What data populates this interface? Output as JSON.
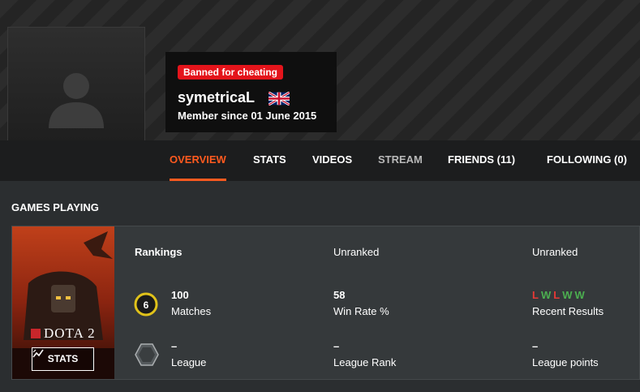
{
  "profile": {
    "ban_badge": "Banned for cheating",
    "username": "symetricaL",
    "member_since": "Member since 01 June 2015",
    "flag_icon": "uk-flag-icon",
    "status_color": "#9a9a9a"
  },
  "nav": {
    "tabs": [
      {
        "label": "OVERVIEW",
        "active": true
      },
      {
        "label": "STATS"
      },
      {
        "label": "VIDEOS"
      },
      {
        "label": "STREAM"
      },
      {
        "label": "FRIENDS (11)"
      },
      {
        "label": "FOLLOWING (0)"
      }
    ],
    "accent": "#ff5a1f"
  },
  "games_section": {
    "title": "GAMES PLAYING",
    "game": {
      "name": "DOTA 2",
      "stats_button": "STATS",
      "rankings_label": "Rankings",
      "ranking_1": "Unranked",
      "ranking_2": "Unranked",
      "matches_value": "100",
      "matches_label": "Matches",
      "medal_level": "6",
      "win_rate_value": "58",
      "win_rate_label": "Win Rate %",
      "recent_results": [
        "L",
        "W",
        "L",
        "W",
        "W"
      ],
      "recent_results_label": "Recent Results",
      "league_value": "–",
      "league_label": "League",
      "league_rank_value": "–",
      "league_rank_label": "League Rank",
      "league_points_value": "–",
      "league_points_label": "League points"
    }
  },
  "colors": {
    "win": "#4caf50",
    "loss": "#e53935",
    "ban": "#e4141b"
  }
}
